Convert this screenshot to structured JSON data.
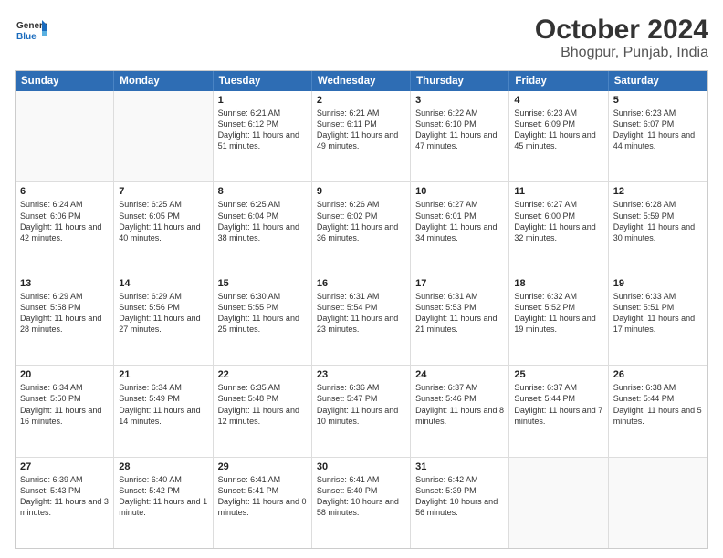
{
  "logo": {
    "line1": "General",
    "line2": "Blue"
  },
  "title": "October 2024",
  "subtitle": "Bhogpur, Punjab, India",
  "days": [
    "Sunday",
    "Monday",
    "Tuesday",
    "Wednesday",
    "Thursday",
    "Friday",
    "Saturday"
  ],
  "weeks": [
    [
      {
        "day": "",
        "sunrise": "",
        "sunset": "",
        "daylight": ""
      },
      {
        "day": "",
        "sunrise": "",
        "sunset": "",
        "daylight": ""
      },
      {
        "day": "1",
        "sunrise": "Sunrise: 6:21 AM",
        "sunset": "Sunset: 6:12 PM",
        "daylight": "Daylight: 11 hours and 51 minutes."
      },
      {
        "day": "2",
        "sunrise": "Sunrise: 6:21 AM",
        "sunset": "Sunset: 6:11 PM",
        "daylight": "Daylight: 11 hours and 49 minutes."
      },
      {
        "day": "3",
        "sunrise": "Sunrise: 6:22 AM",
        "sunset": "Sunset: 6:10 PM",
        "daylight": "Daylight: 11 hours and 47 minutes."
      },
      {
        "day": "4",
        "sunrise": "Sunrise: 6:23 AM",
        "sunset": "Sunset: 6:09 PM",
        "daylight": "Daylight: 11 hours and 45 minutes."
      },
      {
        "day": "5",
        "sunrise": "Sunrise: 6:23 AM",
        "sunset": "Sunset: 6:07 PM",
        "daylight": "Daylight: 11 hours and 44 minutes."
      }
    ],
    [
      {
        "day": "6",
        "sunrise": "Sunrise: 6:24 AM",
        "sunset": "Sunset: 6:06 PM",
        "daylight": "Daylight: 11 hours and 42 minutes."
      },
      {
        "day": "7",
        "sunrise": "Sunrise: 6:25 AM",
        "sunset": "Sunset: 6:05 PM",
        "daylight": "Daylight: 11 hours and 40 minutes."
      },
      {
        "day": "8",
        "sunrise": "Sunrise: 6:25 AM",
        "sunset": "Sunset: 6:04 PM",
        "daylight": "Daylight: 11 hours and 38 minutes."
      },
      {
        "day": "9",
        "sunrise": "Sunrise: 6:26 AM",
        "sunset": "Sunset: 6:02 PM",
        "daylight": "Daylight: 11 hours and 36 minutes."
      },
      {
        "day": "10",
        "sunrise": "Sunrise: 6:27 AM",
        "sunset": "Sunset: 6:01 PM",
        "daylight": "Daylight: 11 hours and 34 minutes."
      },
      {
        "day": "11",
        "sunrise": "Sunrise: 6:27 AM",
        "sunset": "Sunset: 6:00 PM",
        "daylight": "Daylight: 11 hours and 32 minutes."
      },
      {
        "day": "12",
        "sunrise": "Sunrise: 6:28 AM",
        "sunset": "Sunset: 5:59 PM",
        "daylight": "Daylight: 11 hours and 30 minutes."
      }
    ],
    [
      {
        "day": "13",
        "sunrise": "Sunrise: 6:29 AM",
        "sunset": "Sunset: 5:58 PM",
        "daylight": "Daylight: 11 hours and 28 minutes."
      },
      {
        "day": "14",
        "sunrise": "Sunrise: 6:29 AM",
        "sunset": "Sunset: 5:56 PM",
        "daylight": "Daylight: 11 hours and 27 minutes."
      },
      {
        "day": "15",
        "sunrise": "Sunrise: 6:30 AM",
        "sunset": "Sunset: 5:55 PM",
        "daylight": "Daylight: 11 hours and 25 minutes."
      },
      {
        "day": "16",
        "sunrise": "Sunrise: 6:31 AM",
        "sunset": "Sunset: 5:54 PM",
        "daylight": "Daylight: 11 hours and 23 minutes."
      },
      {
        "day": "17",
        "sunrise": "Sunrise: 6:31 AM",
        "sunset": "Sunset: 5:53 PM",
        "daylight": "Daylight: 11 hours and 21 minutes."
      },
      {
        "day": "18",
        "sunrise": "Sunrise: 6:32 AM",
        "sunset": "Sunset: 5:52 PM",
        "daylight": "Daylight: 11 hours and 19 minutes."
      },
      {
        "day": "19",
        "sunrise": "Sunrise: 6:33 AM",
        "sunset": "Sunset: 5:51 PM",
        "daylight": "Daylight: 11 hours and 17 minutes."
      }
    ],
    [
      {
        "day": "20",
        "sunrise": "Sunrise: 6:34 AM",
        "sunset": "Sunset: 5:50 PM",
        "daylight": "Daylight: 11 hours and 16 minutes."
      },
      {
        "day": "21",
        "sunrise": "Sunrise: 6:34 AM",
        "sunset": "Sunset: 5:49 PM",
        "daylight": "Daylight: 11 hours and 14 minutes."
      },
      {
        "day": "22",
        "sunrise": "Sunrise: 6:35 AM",
        "sunset": "Sunset: 5:48 PM",
        "daylight": "Daylight: 11 hours and 12 minutes."
      },
      {
        "day": "23",
        "sunrise": "Sunrise: 6:36 AM",
        "sunset": "Sunset: 5:47 PM",
        "daylight": "Daylight: 11 hours and 10 minutes."
      },
      {
        "day": "24",
        "sunrise": "Sunrise: 6:37 AM",
        "sunset": "Sunset: 5:46 PM",
        "daylight": "Daylight: 11 hours and 8 minutes."
      },
      {
        "day": "25",
        "sunrise": "Sunrise: 6:37 AM",
        "sunset": "Sunset: 5:44 PM",
        "daylight": "Daylight: 11 hours and 7 minutes."
      },
      {
        "day": "26",
        "sunrise": "Sunrise: 6:38 AM",
        "sunset": "Sunset: 5:44 PM",
        "daylight": "Daylight: 11 hours and 5 minutes."
      }
    ],
    [
      {
        "day": "27",
        "sunrise": "Sunrise: 6:39 AM",
        "sunset": "Sunset: 5:43 PM",
        "daylight": "Daylight: 11 hours and 3 minutes."
      },
      {
        "day": "28",
        "sunrise": "Sunrise: 6:40 AM",
        "sunset": "Sunset: 5:42 PM",
        "daylight": "Daylight: 11 hours and 1 minute."
      },
      {
        "day": "29",
        "sunrise": "Sunrise: 6:41 AM",
        "sunset": "Sunset: 5:41 PM",
        "daylight": "Daylight: 11 hours and 0 minutes."
      },
      {
        "day": "30",
        "sunrise": "Sunrise: 6:41 AM",
        "sunset": "Sunset: 5:40 PM",
        "daylight": "Daylight: 10 hours and 58 minutes."
      },
      {
        "day": "31",
        "sunrise": "Sunrise: 6:42 AM",
        "sunset": "Sunset: 5:39 PM",
        "daylight": "Daylight: 10 hours and 56 minutes."
      },
      {
        "day": "",
        "sunrise": "",
        "sunset": "",
        "daylight": ""
      },
      {
        "day": "",
        "sunrise": "",
        "sunset": "",
        "daylight": ""
      }
    ]
  ]
}
